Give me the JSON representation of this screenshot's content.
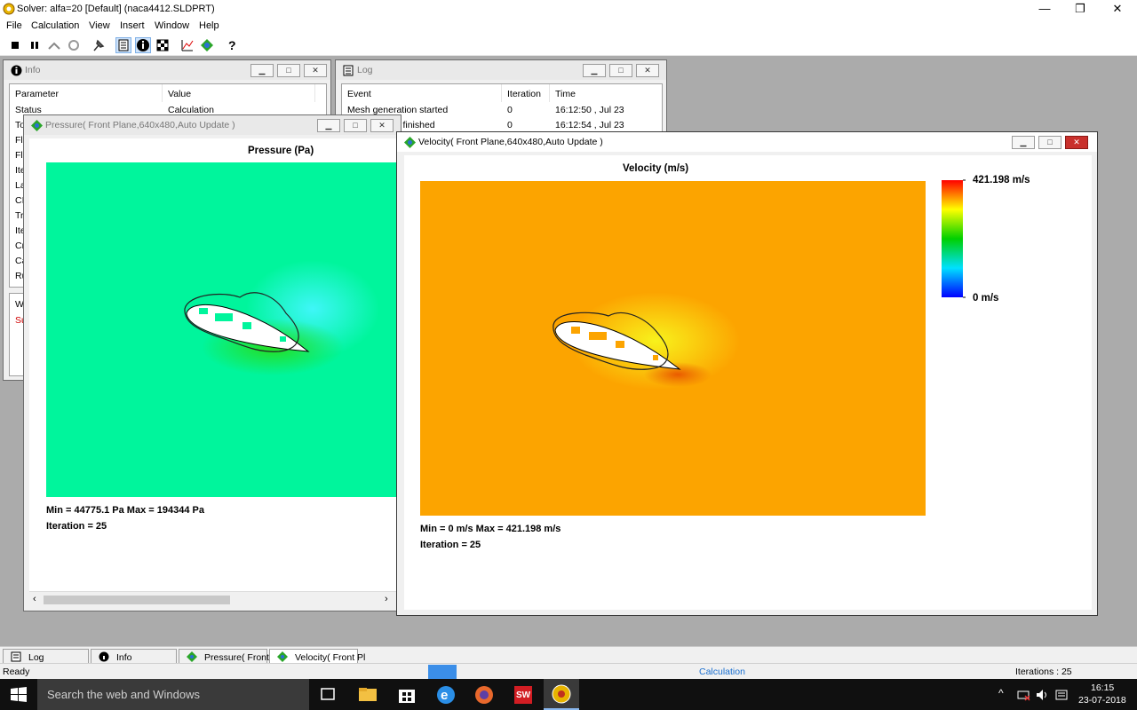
{
  "app": {
    "title": "Solver: alfa=20 [Default] (naca4412.SLDPRT)",
    "window_controls": [
      "—",
      "❐",
      "✕"
    ]
  },
  "menu": [
    "File",
    "Calculation",
    "View",
    "Insert",
    "Window",
    "Help"
  ],
  "toolbar": {
    "icons": [
      "stop-icon",
      "pause-icon",
      "suspend-icon",
      "refresh-icon",
      "pin-icon",
      "log-icon",
      "info-icon",
      "goals-icon",
      "plot-icon",
      "preview-icon",
      "help-icon"
    ]
  },
  "info_window": {
    "title": "Info",
    "headers": [
      "Parameter",
      "Value"
    ],
    "rows": [
      {
        "param": "Status",
        "value": "Calculation"
      },
      {
        "param": "To",
        "value": ""
      },
      {
        "param": "Fl",
        "value": ""
      },
      {
        "param": "Fl",
        "value": ""
      },
      {
        "param": "Ite",
        "value": ""
      },
      {
        "param": "La",
        "value": ""
      },
      {
        "param": "CI",
        "value": ""
      },
      {
        "param": "Tr",
        "value": ""
      },
      {
        "param": "Ite",
        "value": ""
      },
      {
        "param": "Cr",
        "value": ""
      },
      {
        "param": "Ca",
        "value": ""
      },
      {
        "param": "Ru",
        "value": ""
      }
    ],
    "lower_rows": [
      "W",
      "Su"
    ]
  },
  "log_window": {
    "title": "Log",
    "headers": [
      "Event",
      "Iteration",
      "Time"
    ],
    "rows": [
      {
        "event": "Mesh generation started",
        "iteration": "0",
        "time": "16:12:50 , Jul 23"
      },
      {
        "event": "tion normally finished",
        "iteration": "0",
        "time": "16:12:54 , Jul 23"
      }
    ]
  },
  "pressure_window": {
    "title": "Pressure( Front Plane,640x480,Auto Update )",
    "plot_title": "Pressure (Pa)",
    "minmax": "Min = 44775.1 Pa   Max = 194344 Pa",
    "iteration": "Iteration = 25",
    "colors": {
      "base": "#00f59c",
      "low": "#27dd1f",
      "high": "#3ff6f8"
    }
  },
  "velocity_window": {
    "title": "Velocity( Front Plane,640x480,Auto Update )",
    "plot_title": "Velocity (m/s)",
    "legend_max": "421.198 m/s",
    "legend_min": "0 m/s",
    "minmax": "Min = 0 m/s   Max = 421.198 m/s",
    "iteration": "Iteration = 25",
    "colors": {
      "base": "#fca400",
      "fast": "#f8f21c",
      "slow": "#ea5b00"
    }
  },
  "tabs": [
    {
      "label": "Log",
      "icon": "log-icon"
    },
    {
      "label": "Info",
      "icon": "info-icon"
    },
    {
      "label": "Pressure( Front F",
      "icon": "plot-icon"
    },
    {
      "label": "Velocity( Front Pl",
      "icon": "plot-icon"
    }
  ],
  "status": {
    "ready": "Ready",
    "progress_label": "Calculation",
    "iterations": "Iterations : 25"
  },
  "taskbar": {
    "search_placeholder": "Search the web and Windows",
    "time": "16:15",
    "date": "23-07-2018"
  }
}
